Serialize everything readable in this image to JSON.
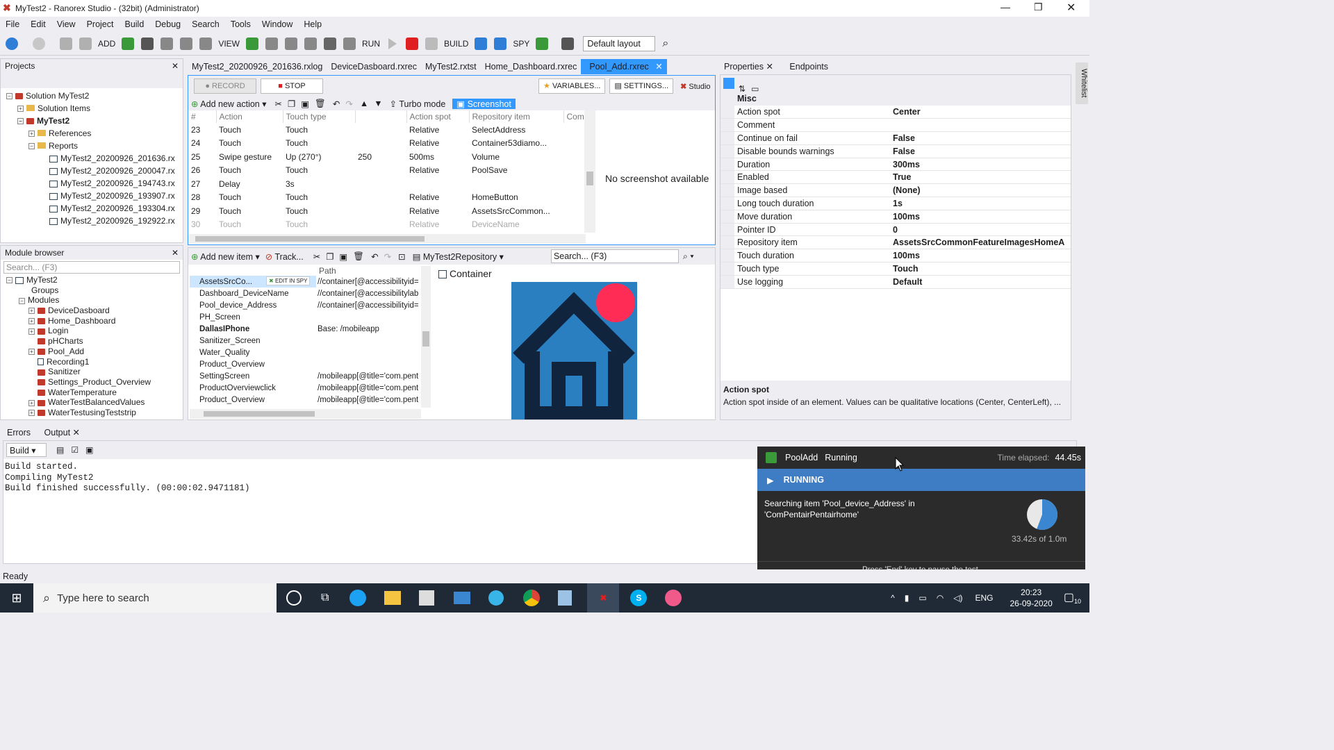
{
  "window": {
    "title": "MyTest2 - Ranorex Studio - (32bit) (Administrator)"
  },
  "menu": [
    "File",
    "Edit",
    "View",
    "Project",
    "Build",
    "Debug",
    "Search",
    "Tools",
    "Window",
    "Help"
  ],
  "toolbar": {
    "add": "ADD",
    "view": "VIEW",
    "run": "RUN",
    "build": "BUILD",
    "spy": "SPY",
    "layout": "Default layout"
  },
  "projects": {
    "title": "Projects",
    "items": [
      "Solution MyTest2",
      "Solution Items",
      "MyTest2",
      "References",
      "Reports",
      "MyTest2_20200926_201636.rx",
      "MyTest2_20200926_200047.rx",
      "MyTest2_20200926_194743.rx",
      "MyTest2_20200926_193907.rx",
      "MyTest2_20200926_193304.rx",
      "MyTest2_20200926_192922.rx"
    ]
  },
  "modules": {
    "title": "Module browser",
    "search": "Search... (F3)",
    "items": [
      "MyTest2",
      "Groups",
      "Modules",
      "DeviceDasboard",
      "Home_Dashboard",
      "Login",
      "pHCharts",
      "Pool_Add",
      "Recording1",
      "Sanitizer",
      "Settings_Product_Overview",
      "WaterTemperature",
      "WaterTestBalancedValues",
      "WaterTestusingTeststrip"
    ]
  },
  "doctabs": [
    "MyTest2_20200926_201636.rxlog",
    "DeviceDasboard.rxrec",
    "MyTest2.rxtst",
    "Home_Dashboard.rxrec",
    "Pool_Add.rxrec"
  ],
  "recorder": {
    "record": "RECORD",
    "stop": "STOP",
    "variables": "VARIABLES...",
    "settings": "SETTINGS...",
    "studio": "Studio",
    "add_action": "Add new action",
    "turbo": "Turbo mode",
    "screenshot": "Screenshot",
    "no_screenshot": "No screenshot available"
  },
  "actions": {
    "headers": [
      "#",
      "Action",
      "Touch type",
      "",
      "Action spot",
      "Repository item",
      "Com"
    ],
    "rows": [
      [
        "23",
        "Touch",
        "Touch",
        "",
        "Relative",
        "SelectAddress"
      ],
      [
        "24",
        "Touch",
        "Touch",
        "",
        "Relative",
        "Container53diamo..."
      ],
      [
        "25",
        "Swipe gesture",
        "Up (270°)",
        "250",
        "500ms",
        "Volume"
      ],
      [
        "26",
        "Touch",
        "Touch",
        "",
        "Relative",
        "PoolSave"
      ],
      [
        "27",
        "Delay",
        "3s",
        "",
        "",
        ""
      ],
      [
        "28",
        "Touch",
        "Touch",
        "",
        "Relative",
        "HomeButton"
      ],
      [
        "29",
        "Touch",
        "Touch",
        "",
        "Relative",
        "AssetsSrcCommon..."
      ],
      [
        "30",
        "Touch",
        "Touch",
        "",
        "Relative",
        "DeviceName"
      ]
    ]
  },
  "repo": {
    "add_item": "Add new item",
    "track": "Track...",
    "name": "MyTest2Repository",
    "search": "Search... (F3)",
    "path_header": "Path",
    "edit_in_spy": "EDIT IN SPY",
    "preview_title": "Container",
    "rows": [
      [
        "AssetsSrcCo...",
        "//container[@accessibilityid="
      ],
      [
        "Dashboard_DeviceName",
        "//container[@accessibilitylab"
      ],
      [
        "Pool_device_Address",
        "//container[@accessibilityid="
      ],
      [
        "PH_Screen",
        ""
      ],
      [
        "DallasIPhone",
        "Base: /mobileapp"
      ],
      [
        "Sanitizer_Screen",
        ""
      ],
      [
        "Water_Quality",
        ""
      ],
      [
        "Product_Overview",
        ""
      ],
      [
        "SettingScreen",
        "/mobileapp[@title='com.pent"
      ],
      [
        "ProductOverviewclick",
        "/mobileapp[@title='com.pent"
      ],
      [
        "Product_Overview",
        "/mobileapp[@title='com.pent"
      ]
    ]
  },
  "properties": {
    "tab": "Properties",
    "tab2": "Endpoints",
    "category": "Misc",
    "rows": [
      [
        "Action spot",
        "Center"
      ],
      [
        "Comment",
        ""
      ],
      [
        "Continue on fail",
        "False"
      ],
      [
        "Disable bounds warnings",
        "False"
      ],
      [
        "Duration",
        "300ms"
      ],
      [
        "Enabled",
        "True"
      ],
      [
        "Image based",
        "(None)"
      ],
      [
        "Long touch duration",
        "1s"
      ],
      [
        "Move duration",
        "100ms"
      ],
      [
        "Pointer ID",
        "0"
      ],
      [
        "Repository item",
        "AssetsSrcCommonFeatureImagesHomeA"
      ],
      [
        "Touch duration",
        "100ms"
      ],
      [
        "Touch type",
        "Touch"
      ],
      [
        "Use logging",
        "Default"
      ]
    ],
    "desc_title": "Action spot",
    "desc": "Action spot inside of an element. Values can be qualitative locations (Center, CenterLeft), ..."
  },
  "output": {
    "tab1": "Errors",
    "tab2": "Output",
    "build": "Build",
    "lines": [
      "Build started.",
      "Compiling MyTest2",
      "Build finished successfully. (00:00:02.9471181)"
    ]
  },
  "runner": {
    "name": "PoolAdd",
    "status": "Running",
    "elapsed_label": "Time elapsed:",
    "elapsed": "44.45s",
    "running": "RUNNING",
    "msg1": "Searching item 'Pool_device_Address' in",
    "msg2": "'ComPentairPentairhome'",
    "progress_text": "33.42s of 1.0m",
    "progress": 0.557,
    "hint": "Press 'End' key to pause the test."
  },
  "status": "Ready",
  "whitelist": "Whitelist",
  "taskbar": {
    "search": "Type here to search",
    "lang": "ENG",
    "time": "20:23",
    "date": "26-09-2020",
    "notif": "10"
  },
  "colors": {
    "accent": "#2e7dd7",
    "selected_tab": "#3399ff",
    "running": "#3e7cc4",
    "dark_panel": "#2b2b2b",
    "taskbar": "#1f2a36"
  }
}
